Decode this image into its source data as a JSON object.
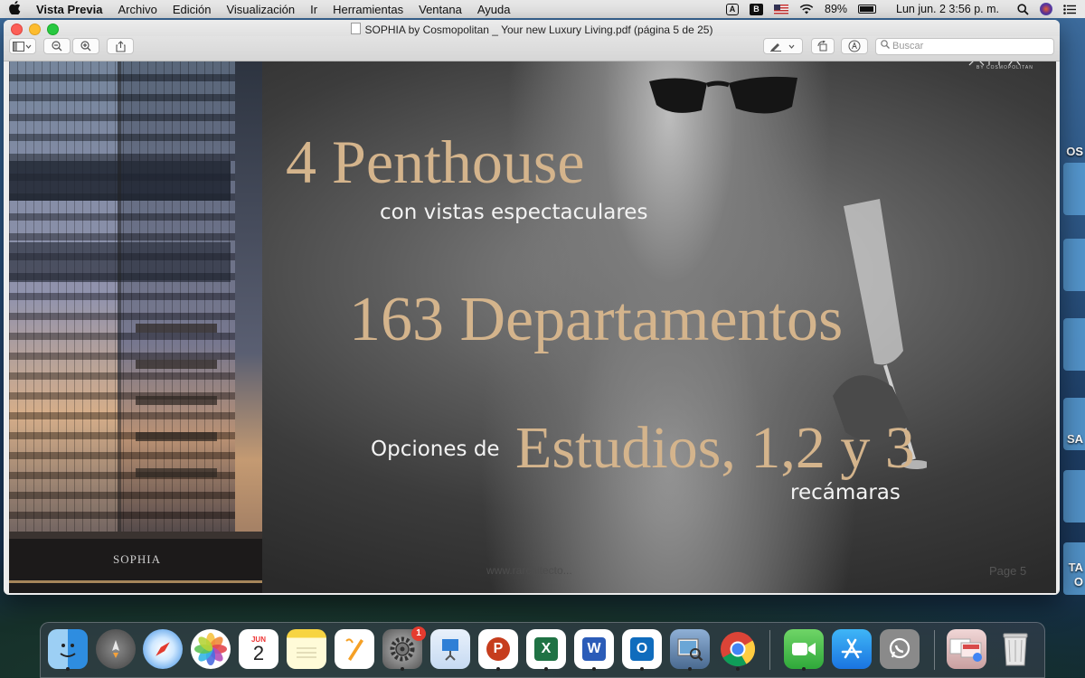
{
  "menubar": {
    "apple": "",
    "app_name": "Vista Previa",
    "items": [
      "Archivo",
      "Edición",
      "Visualización",
      "Ir",
      "Herramientas",
      "Ventana",
      "Ayuda"
    ],
    "status": {
      "a_icon": "A",
      "b_icon": "B",
      "battery": "89%",
      "clock": "Lun jun. 2  3:56 p. m."
    }
  },
  "window": {
    "title": "SOPHIA by Cosmopolitan _ Your new Luxury Living.pdf (página 5 de 25)",
    "search_placeholder": "Buscar"
  },
  "page": {
    "headline1": "4 Penthouse",
    "sub1": "con vistas espectaculares",
    "headline2": "163 Departamentos",
    "prefix3": "Opciones de",
    "headline3": "Estudios, 1,2 y 3",
    "sub3": "recámaras",
    "building_sign": "SOPHIA",
    "logo_small": "BY COSMOPOLITAN",
    "watermark": "www.rarchitecto...",
    "page_number": "Page 5"
  },
  "desktop": {
    "label1": "OS",
    "label2": "SA",
    "label3": "TA",
    "label4": "O"
  },
  "dock": {
    "calendar_month": "JUN",
    "calendar_day": "2",
    "settings_badge": "1",
    "items": [
      "finder-icon",
      "launchpad-icon",
      "safari-icon",
      "photos-icon",
      "calendar-icon",
      "notes-icon",
      "pages-icon",
      "system-preferences-icon",
      "keynote-icon",
      "powerpoint-icon",
      "excel-icon",
      "word-icon",
      "outlook-icon",
      "preview-icon",
      "chrome-icon",
      "facetime-icon",
      "app-store-icon",
      "whatsapp-icon",
      "downloads-stack-icon",
      "trash-icon"
    ],
    "letters": {
      "powerpoint": "P",
      "excel": "X",
      "word": "W",
      "outlook": "O"
    }
  }
}
